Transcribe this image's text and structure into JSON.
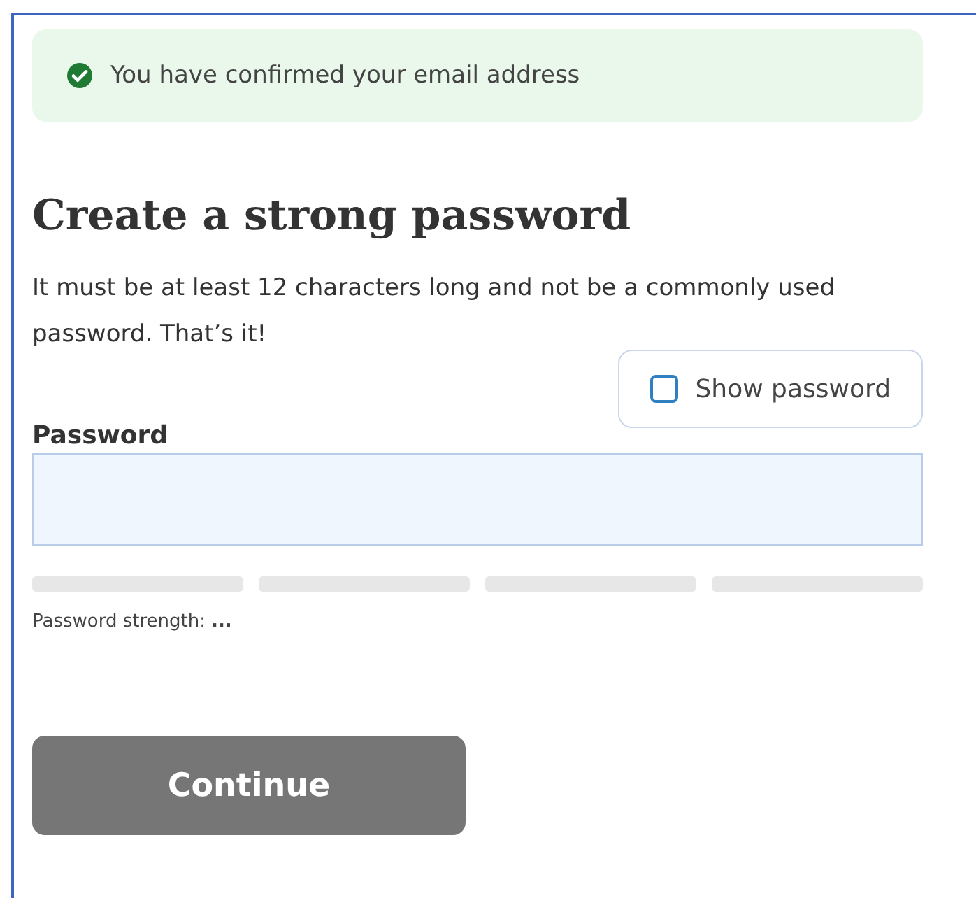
{
  "banner": {
    "text": "You have confirmed your email address"
  },
  "heading": "Create a strong password",
  "intro": "It must be at least 12 characters long and not be a commonly used password. That’s it!",
  "show_password": {
    "label": "Show password",
    "checked": false
  },
  "password": {
    "label": "Password"
  },
  "strength_segments": [
    {
      "filled": false
    },
    {
      "filled": false
    },
    {
      "filled": false
    },
    {
      "filled": false
    }
  ],
  "strength": {
    "label": "Password strength:",
    "value": "..."
  },
  "continue_button": {
    "label": "Continue",
    "disabled": true
  }
}
